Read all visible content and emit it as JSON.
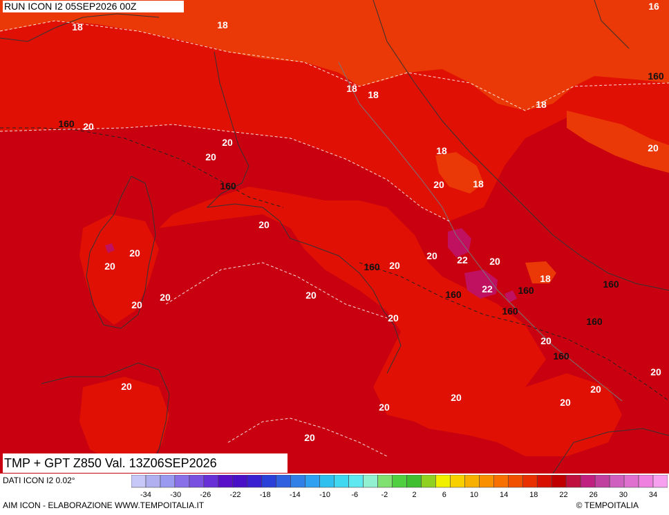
{
  "header": {
    "run_title": "RUN ICON I2 05SEP2026 00Z",
    "main_title": "TMP + GPT Z850 Val. 13Z06SEP2026"
  },
  "footer": {
    "source": "DATI ICON I2 0.02°",
    "credit": "AIM ICON - ELABORAZIONE WWW.TEMPOITALIA.IT",
    "copyright": "© TEMPOITALIA"
  },
  "legend": {
    "colors": [
      "#c8c8f8",
      "#b0b0f0",
      "#9a9af0",
      "#8a70e8",
      "#7a50e0",
      "#6a30d8",
      "#5a10c8",
      "#4a10c8",
      "#3a20d0",
      "#2a40d8",
      "#3060e0",
      "#3080e8",
      "#30a0f0",
      "#30c0f0",
      "#40d8f0",
      "#60e8f0",
      "#90f0d0",
      "#80e070",
      "#50d040",
      "#40c030",
      "#90d020",
      "#f0f000",
      "#f8d000",
      "#f8b000",
      "#f89000",
      "#f87000",
      "#f05000",
      "#e83000",
      "#d81000",
      "#c00000",
      "#c01040",
      "#c02080",
      "#c040a0",
      "#d060c0",
      "#e070d0",
      "#f080e0",
      "#f8a0f0"
    ],
    "tick_labels": [
      "-34",
      "-30",
      "-26",
      "-22",
      "-18",
      "-14",
      "-10",
      "-6",
      "-2",
      "2",
      "6",
      "10",
      "14",
      "18",
      "22",
      "26",
      "30",
      "34"
    ]
  },
  "map": {
    "colors": {
      "band_18": "#ea3806",
      "band_18_20": "#e01004",
      "band_20_22": "#c80010",
      "band_22": "#c01060",
      "coast": "#333333",
      "border": "#777777"
    },
    "temperature_labels": [
      "18",
      "18",
      "16",
      "160",
      "18",
      "18",
      "18",
      "160",
      "20",
      "20",
      "20",
      "18",
      "160",
      "20",
      "18",
      "20",
      "20",
      "20",
      "20",
      "160",
      "20",
      "22",
      "20",
      "20",
      "22",
      "160",
      "160",
      "18",
      "160",
      "20",
      "160",
      "160",
      "20",
      "20",
      "20",
      "20",
      "160",
      "20",
      "20",
      "20",
      "20",
      "20",
      "20",
      "20"
    ]
  }
}
